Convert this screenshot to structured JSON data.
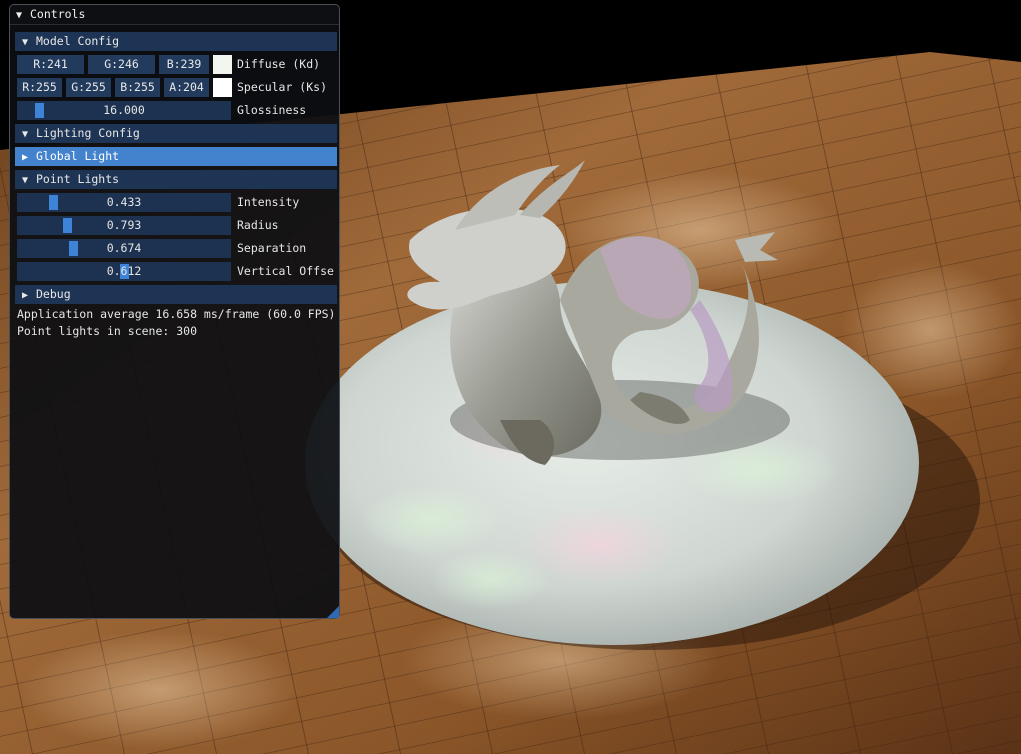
{
  "window": {
    "title": "Controls"
  },
  "model_config": {
    "header": "Model Config",
    "diffuse": {
      "r": "R:241",
      "g": "G:246",
      "b": "B:239",
      "label": "Diffuse (Kd)",
      "color": "#f1f6ef"
    },
    "specular": {
      "r": "R:255",
      "g": "G:255",
      "b": "B:255",
      "a": "A:204",
      "label": "Specular (Ks)",
      "color": "#ffffff"
    },
    "glossiness": {
      "value": "16.000",
      "label": "Glossiness",
      "fraction": 0.08
    }
  },
  "lighting_config": {
    "header": "Lighting Config",
    "global_light": {
      "header": "Global Light"
    },
    "point_lights": {
      "header": "Point Lights",
      "intensity": {
        "value": "0.433",
        "label": "Intensity",
        "fraction": 0.15
      },
      "radius": {
        "value": "0.793",
        "label": "Radius",
        "fraction": 0.22
      },
      "separation": {
        "value": "0.674",
        "label": "Separation",
        "fraction": 0.25
      },
      "vertical_offset": {
        "value": "0.612",
        "label": "Vertical Offse",
        "fraction": 0.5
      }
    }
  },
  "debug": {
    "header": "Debug"
  },
  "stats": {
    "fps_line": "Application average 16.658 ms/frame (60.0 FPS)",
    "lights_line": "Point lights in scene: 300"
  },
  "icons": {
    "expanded": "▼",
    "collapsed": "▶"
  },
  "colors": {
    "header_bg": "#1e3454",
    "header_active": "#4382cc",
    "slider_grab": "#3d84d8",
    "floor_wood": "#8a5a30"
  }
}
